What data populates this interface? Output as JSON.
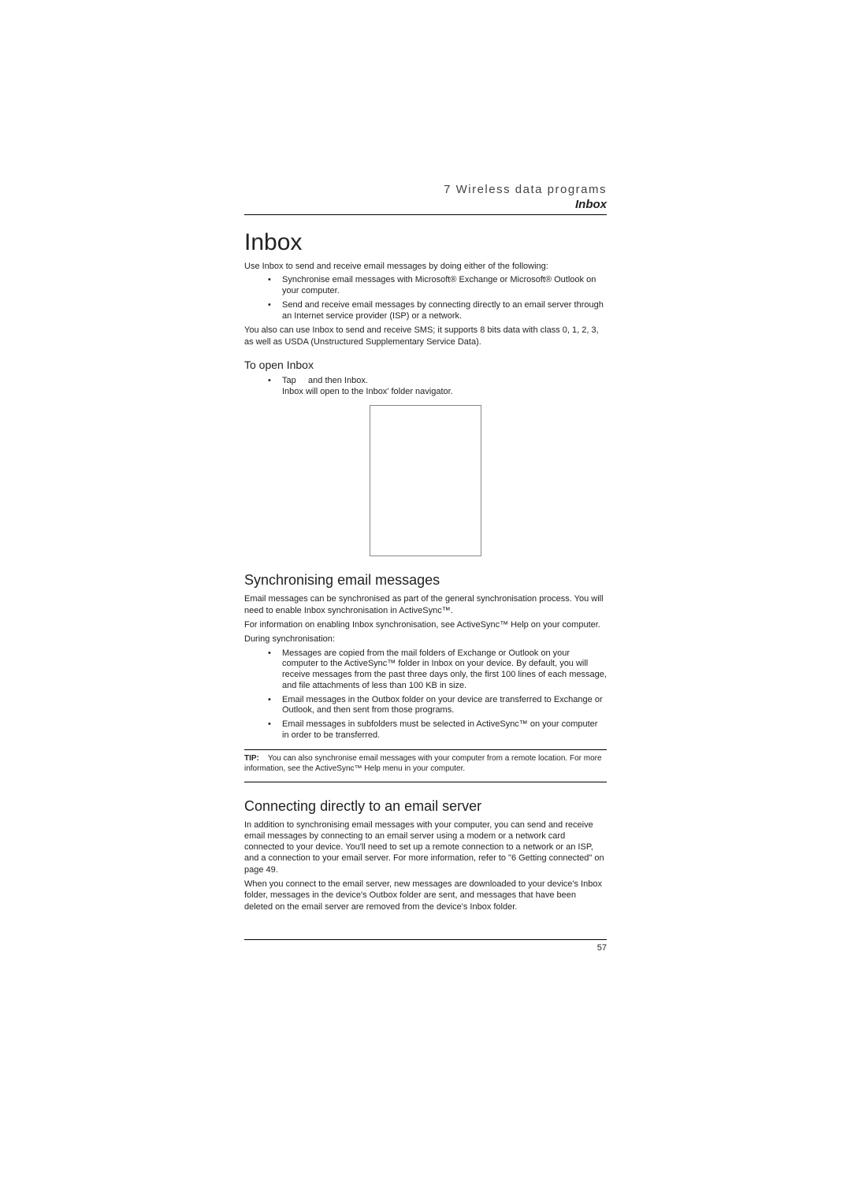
{
  "header": {
    "chapter": "7 Wireless data programs",
    "section": "Inbox"
  },
  "h1": "Inbox",
  "intro": "Use Inbox to send and receive email messages by doing either of the following:",
  "intro_bullets": [
    "Synchronise email messages with Microsoft® Exchange or Microsoft® Outlook on your computer.",
    "Send and receive email messages by connecting directly to an email server through an Internet service provider (ISP) or a network."
  ],
  "intro_after": "You also can use Inbox to send and receive SMS; it supports 8 bits data with class 0, 1, 2, 3, as well as USDA (Unstructured Supplementary Service Data).",
  "open_heading": "To open Inbox",
  "open_bullet_pre": "Tap ",
  "open_bullet_post": " and then Inbox.",
  "open_bullet_sub": "Inbox will open to the Inbox' folder navigator.",
  "sync_heading": "Synchronising email messages",
  "sync_p1": "Email messages can be synchronised as part of the general synchronisation process. You will need to enable Inbox synchronisation in ActiveSync™.",
  "sync_p2": "For information on enabling Inbox synchronisation, see ActiveSync™ Help on your computer.",
  "sync_p3": "During synchronisation:",
  "sync_bullets": [
    "Messages are copied from the mail folders of Exchange or Outlook on your computer to the ActiveSync™ folder in Inbox on your device. By default, you will receive messages from the past three days only, the first 100 lines of each message, and file attachments of less than 100 KB in size.",
    "Email messages in the Outbox folder on your device are transferred to Exchange or Outlook, and then sent from those programs.",
    "Email messages in subfolders must be selected in ActiveSync™ on your computer in order to be transferred."
  ],
  "tip_label": "TIP:",
  "tip_text": "You can also synchronise email messages with your computer from a remote location. For more information, see the ActiveSync™ Help menu in your computer.",
  "connect_heading": "Connecting directly to an email server",
  "connect_p1": "In addition to synchronising email messages with your computer, you can send and receive email messages by connecting to an email server using a modem or a network card connected to your device. You'll need to set up a remote connection to a network or an ISP, and a connection to your email server. For more information, refer to \"6 Getting connected\" on page 49.",
  "connect_p2": "When you connect to the email server, new messages are downloaded to your device's Inbox folder, messages in the device's Outbox folder are sent, and messages that have been deleted on the email server are removed from the device's Inbox folder.",
  "page_number": "57"
}
